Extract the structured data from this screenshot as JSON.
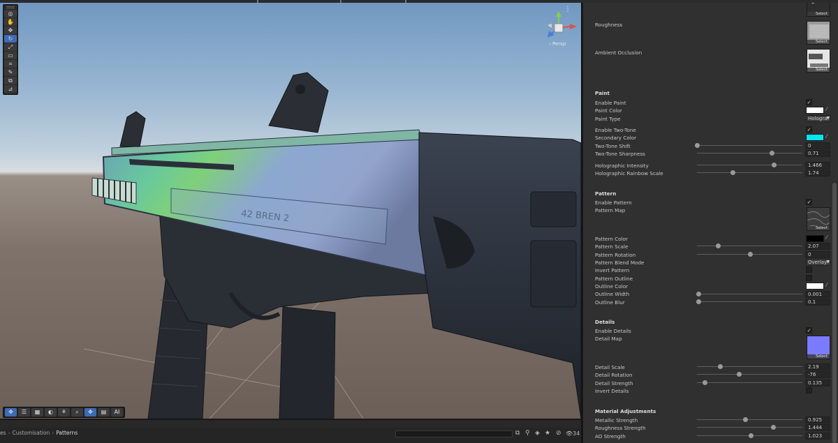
{
  "scene": {
    "persp_label": "‹ Persp",
    "bottom_tools": [
      "✥",
      "☰",
      "▦",
      "◐",
      "⚘",
      "⌕",
      "✥",
      "▤",
      "AI"
    ]
  },
  "statusbar": {
    "breadcrumb": [
      "es",
      "Customisation",
      "Patterns"
    ],
    "search_placeholder": "",
    "visible_count": "34"
  },
  "inspector": {
    "top_maps": {
      "roughness_label": "Roughness",
      "ao_label": "Ambient Occlusion",
      "select_label": "Select"
    },
    "paint": {
      "header": "Paint",
      "enable_label": "Enable Paint",
      "color_label": "Paint Color",
      "color": "#ffffff",
      "type_label": "Paint Type",
      "type_value": "Hologra",
      "two_tone_label": "Enable Two-Tone",
      "secondary_label": "Secondary Color",
      "secondary_color": "#00e5f0",
      "shift_label": "Two-Tone Shift",
      "shift_value": "0",
      "sharpness_label": "Two-Tone Sharpness",
      "sharpness_value": "0.71",
      "holo_label": "Holographic Intensity",
      "holo_value": "1.466",
      "rainbow_label": "Holographic Rainbow Scale",
      "rainbow_value": "1.74"
    },
    "pattern": {
      "header": "Pattern",
      "enable_label": "Enable Pattern",
      "map_label": "Pattern Map",
      "color_label": "Pattern Color",
      "color": "#000000",
      "scale_label": "Pattern Scale",
      "scale_value": "2.07",
      "rotation_label": "Pattern Rotation",
      "rotation_value": "0",
      "blend_label": "Pattern Blend Mode",
      "blend_value": "Overlay",
      "invert_label": "Invert Pattern",
      "outline_label": "Pattern Outline",
      "outline_color_label": "Outline Color",
      "outline_color": "#ffffff",
      "outline_width_label": "Outline Width",
      "outline_width_value": "0.001",
      "outline_blur_label": "Outline Blur",
      "outline_blur_value": "0.1"
    },
    "details": {
      "header": "Details",
      "enable_label": "Enable Details",
      "map_label": "Detail Map",
      "map_color": "#7b7bff",
      "scale_label": "Detail Scale",
      "scale_value": "2.19",
      "rotation_label": "Detail Rotation",
      "rotation_value": "-76",
      "strength_label": "Detail Strength",
      "strength_value": "0.135",
      "invert_label": "Invert Details"
    },
    "material": {
      "header": "Material Adjustments",
      "metallic_label": "Metallic Strength",
      "metallic_value": "0.925",
      "roughness_label": "Roughness Strength",
      "roughness_value": "1.444",
      "ao_label": "AO Strength",
      "ao_value": "1.023"
    }
  }
}
